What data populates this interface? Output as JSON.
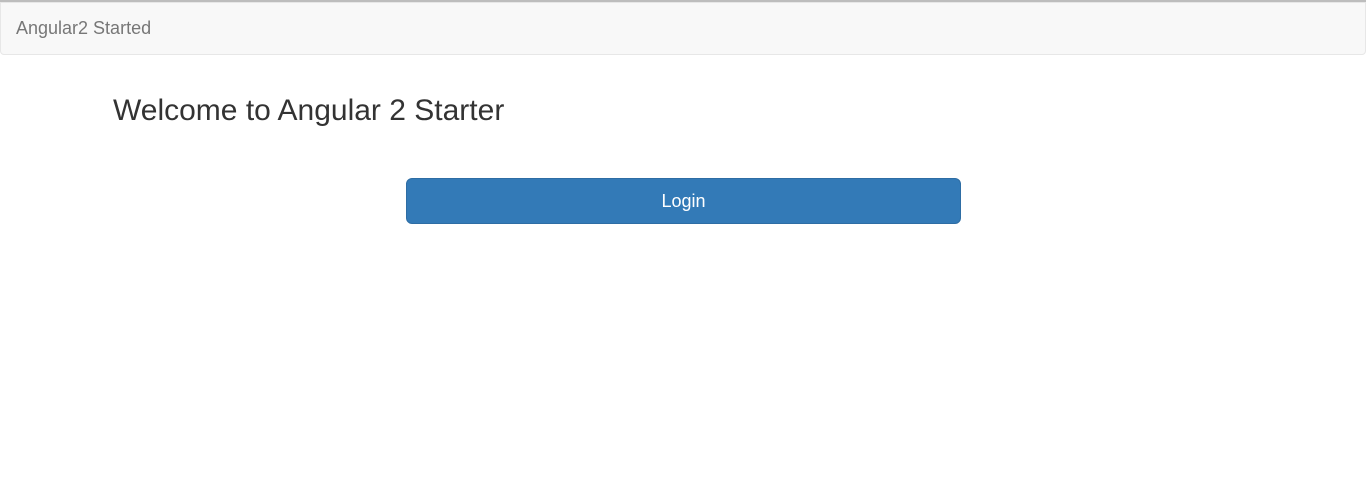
{
  "navbar": {
    "brand": "Angular2 Started"
  },
  "main": {
    "title": "Welcome to Angular 2 Starter",
    "login_label": "Login"
  },
  "colors": {
    "navbar_bg": "#f8f8f8",
    "primary_button": "#337ab7",
    "title_text": "#333333",
    "brand_text": "#777777"
  }
}
